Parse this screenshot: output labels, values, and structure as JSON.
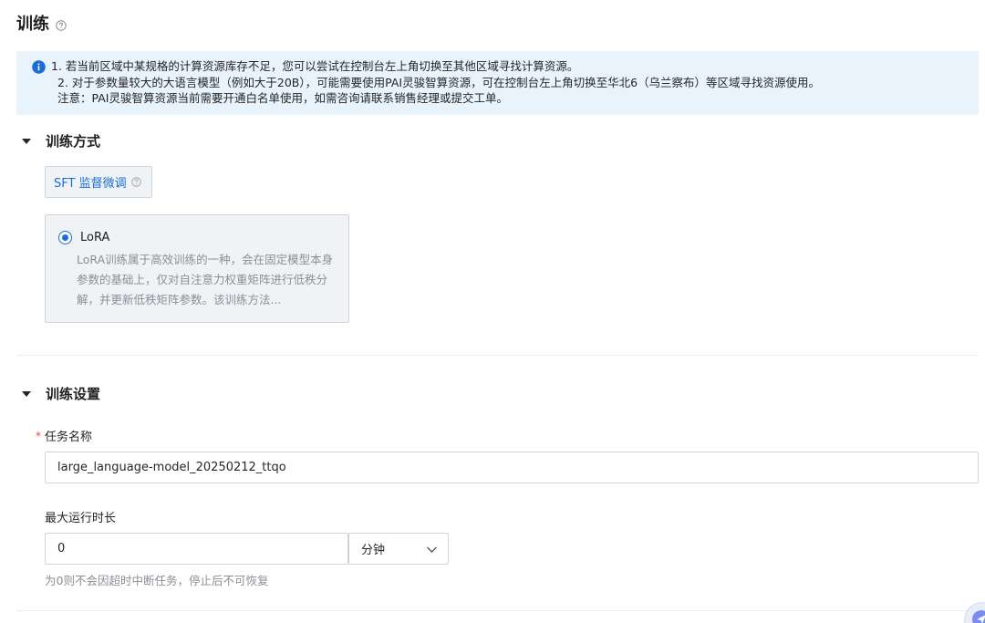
{
  "header": {
    "title": "训练"
  },
  "notice": {
    "lines": [
      "1. 若当前区域中某规格的计算资源库存不足，您可以尝试在控制台左上角切换至其他区域寻找计算资源。",
      "2. 对于参数量较大的大语言模型（例如大于20B），可能需要使用PAI灵骏智算资源，可在控制台左上角切换至华北6（乌兰察布）等区域寻找资源使用。",
      "注意：PAI灵骏智算资源当前需要开通白名单使用，如需咨询请联系销售经理或提交工单。"
    ]
  },
  "training_method": {
    "section_title": "训练方式",
    "tab_label": "SFT 监督微调",
    "option": {
      "name": "LoRA",
      "selected": true,
      "description": "LoRA训练属于高效训练的一种，会在固定模型本身参数的基础上，仅对自注意力权重矩阵进行低秩分解，并更新低秩矩阵参数。该训练方法..."
    }
  },
  "training_settings": {
    "section_title": "训练设置",
    "task_name": {
      "label": "任务名称",
      "required_mark": "*",
      "value": "large_language-model_20250212_ttqo"
    },
    "max_runtime": {
      "label": "最大运行时长",
      "value": "0",
      "unit": "分钟",
      "hint": "为0则不会因超时中断任务，停止后不可恢复"
    }
  },
  "colors": {
    "accent": "#1a6dd6",
    "notice_bg": "#e8f3fc",
    "required": "#e54545"
  }
}
